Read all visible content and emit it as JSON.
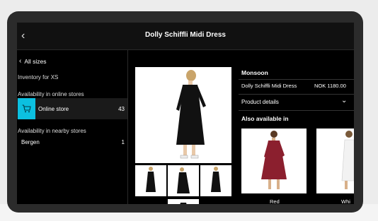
{
  "header": {
    "title": "Dolly Schiffli Midi Dress"
  },
  "sidebar": {
    "back_label": "All sizes",
    "inventory_label": "Inventory for XS",
    "online_section_label": "Availability in online stores",
    "online_store": {
      "label": "Online store",
      "count": "43"
    },
    "nearby_section_label": "Availability in nearby stores",
    "nearby_stores": [
      {
        "label": "Bergen",
        "count": "1"
      }
    ]
  },
  "product": {
    "brand": "Monsoon",
    "name": "Dolly Schiffli Midi Dress",
    "price": "NOK 1180.00",
    "details_label": "Product details",
    "also_available_label": "Also available in",
    "variants": [
      {
        "label": "Red"
      },
      {
        "label": "Whi"
      }
    ]
  },
  "colors": {
    "accent": "#0cc0e0",
    "background": "#000000",
    "variant_red": "#8b1f2e"
  }
}
